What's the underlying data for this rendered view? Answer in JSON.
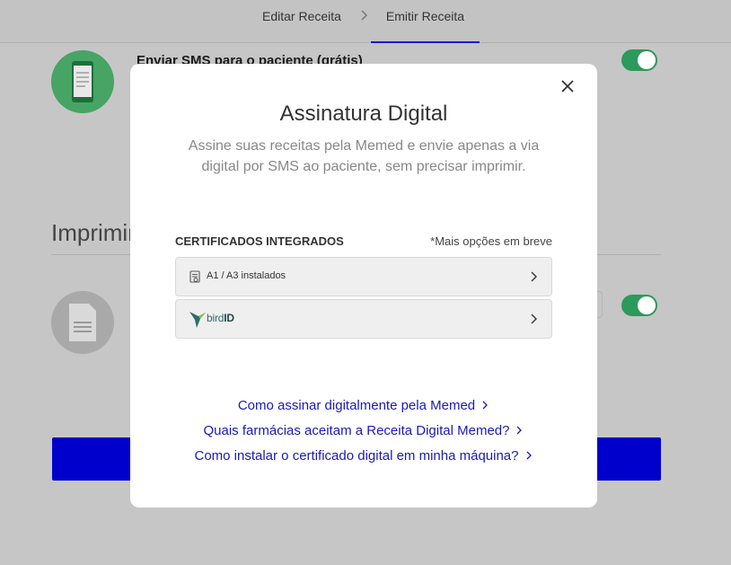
{
  "nav": {
    "tab_edit": "Editar Receita",
    "tab_emit": "Emitir Receita",
    "active_color": "#1a1acc"
  },
  "background": {
    "sms_label": "Enviar SMS para o paciente (grátis)",
    "sms_toggle": true,
    "print_heading": "Imprimir",
    "print_toggle": true,
    "primary_color": "#0000cc"
  },
  "modal": {
    "title": "Assinatura Digital",
    "description": "Assine suas receitas pela Memed e envie apenas a via digital por SMS ao paciente, sem precisar imprimir.",
    "cert_section_title": "CERTIFICADOS INTEGRADOS",
    "cert_note": "*Mais opções em breve",
    "options": [
      {
        "label": "A1 / A3  instalados",
        "icon": "certificate-icon"
      },
      {
        "label_prefix": "bird",
        "label_bold": "ID",
        "icon": "bird-id-logo"
      }
    ],
    "links": [
      "Como assinar digitalmente pela Memed",
      "Quais farmácias aceitam a Receita Digital Memed?",
      "Como instalar o certificado digital em minha máquina?"
    ]
  }
}
